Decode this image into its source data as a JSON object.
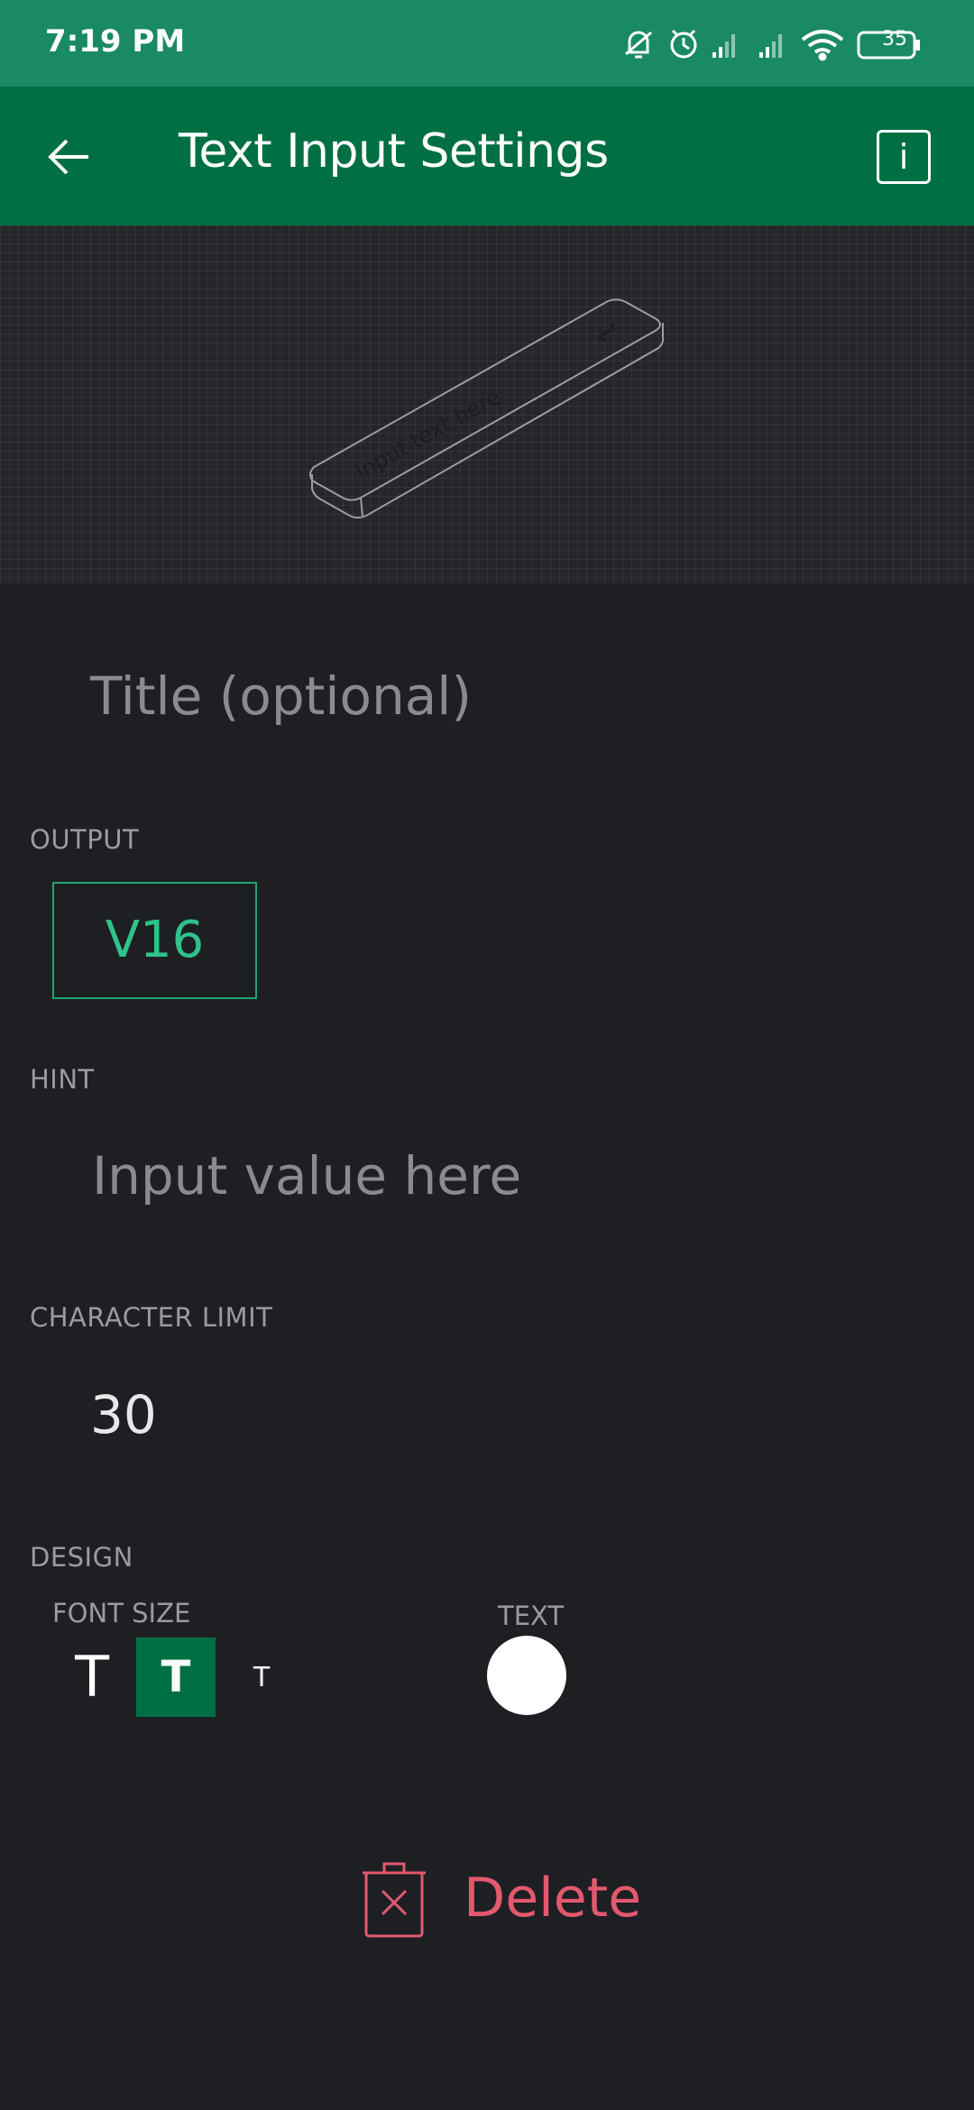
{
  "status_bar": {
    "time": "7:19 PM",
    "battery": "35",
    "icons": [
      "mute-icon",
      "alarm-icon",
      "signal-icon",
      "signal-icon",
      "wifi-icon",
      "battery-icon"
    ]
  },
  "header": {
    "title": "Text Input Settings",
    "back_icon": "arrow-left-icon",
    "info_label": "i"
  },
  "preview": {
    "widget_placeholder": "Input text here"
  },
  "form": {
    "title_placeholder": "Title (optional)",
    "output_label": "OUTPUT",
    "output_pin": "V16",
    "hint_label": "HINT",
    "hint_value": "Input value here",
    "char_limit_label": "CHARACTER LIMIT",
    "char_limit_value": "30",
    "design_label": "DESIGN",
    "font_size_label": "FONT SIZE",
    "font_size_options": [
      "T",
      "T",
      "T"
    ],
    "font_size_selected": "medium",
    "text_label": "TEXT",
    "text_color": "#ffffff"
  },
  "delete": {
    "label": "Delete",
    "color": "#e2596e"
  },
  "colors": {
    "status_bar": "#1a8a62",
    "app_bar": "#016f44",
    "background": "#1e1f23",
    "accent": "#2ec38a"
  }
}
